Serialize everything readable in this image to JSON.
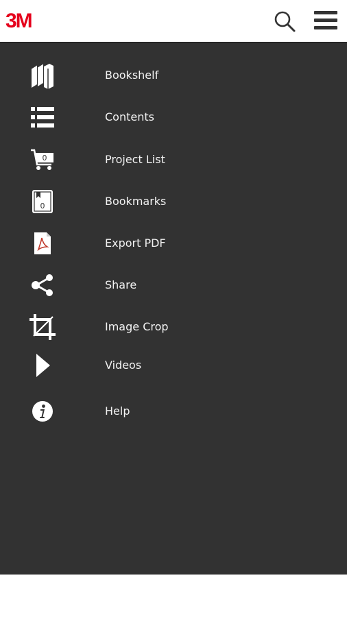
{
  "header": {
    "logo_text": "3M",
    "brand_color": "#e5001c",
    "search_icon": "search-icon",
    "menu_icon": "hamburger-menu-icon"
  },
  "drawer": {
    "background": "#323232",
    "items": [
      {
        "label": "Bookshelf",
        "icon": "bookshelf-icon"
      },
      {
        "label": "Contents",
        "icon": "list-icon"
      },
      {
        "label": "Project List",
        "icon": "cart-icon",
        "badge": "0"
      },
      {
        "label": "Bookmarks",
        "icon": "bookmark-icon",
        "badge": "0"
      },
      {
        "label": "Export PDF",
        "icon": "pdf-icon"
      },
      {
        "label": "Share",
        "icon": "share-icon"
      },
      {
        "label": "Image Crop",
        "icon": "crop-icon"
      },
      {
        "label": "Videos",
        "icon": "play-icon"
      },
      {
        "label": "Help",
        "icon": "info-icon"
      }
    ]
  }
}
